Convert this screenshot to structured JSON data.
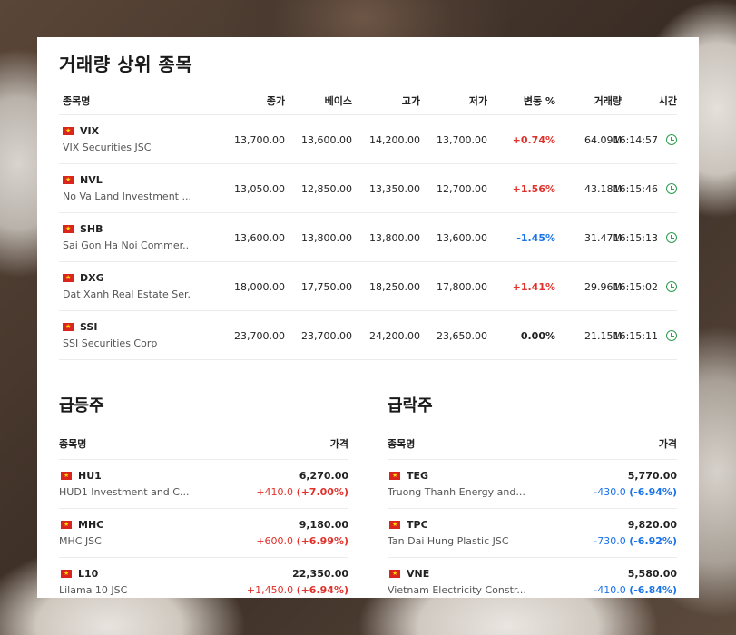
{
  "main": {
    "title": "거래량 상위 종목",
    "headers": {
      "name": "종목명",
      "price": "종가",
      "base": "베이스",
      "high": "고가",
      "low": "저가",
      "change": "변동 %",
      "volume": "거래량",
      "time": "시간"
    },
    "rows": [
      {
        "symbol": "VIX",
        "company": "VIX Securities JSC",
        "price": "13,700.00",
        "base": "13,600.00",
        "high": "14,200.00",
        "low": "13,700.00",
        "change": "+0.74%",
        "volume": "64.09M",
        "time": "16:14:57"
      },
      {
        "symbol": "NVL",
        "company": "No Va Land Investment ...",
        "price": "13,050.00",
        "base": "12,850.00",
        "high": "13,350.00",
        "low": "12,700.00",
        "change": "+1.56%",
        "volume": "43.18M",
        "time": "16:15:46"
      },
      {
        "symbol": "SHB",
        "company": "Sai Gon Ha Noi Commer...",
        "price": "13,600.00",
        "base": "13,800.00",
        "high": "13,800.00",
        "low": "13,600.00",
        "change": "-1.45%",
        "volume": "31.47M",
        "time": "16:15:13"
      },
      {
        "symbol": "DXG",
        "company": "Dat Xanh Real Estate Ser...",
        "price": "18,000.00",
        "base": "17,750.00",
        "high": "18,250.00",
        "low": "17,800.00",
        "change": "+1.41%",
        "volume": "29.96M",
        "time": "16:15:02"
      },
      {
        "symbol": "SSI",
        "company": "SSI Securities Corp",
        "price": "23,700.00",
        "base": "23,700.00",
        "high": "24,200.00",
        "low": "23,650.00",
        "change": "0.00%",
        "volume": "21.15M",
        "time": "16:15:11"
      }
    ]
  },
  "gainers": {
    "title": "급등주",
    "header_name": "종목명",
    "header_price": "가격",
    "rows": [
      {
        "symbol": "HU1",
        "company": "HUD1 Investment and C...",
        "price": "6,270.00",
        "abs": "+410.0",
        "pct": "(+7.00%)"
      },
      {
        "symbol": "MHC",
        "company": "MHC JSC",
        "price": "9,180.00",
        "abs": "+600.0",
        "pct": "(+6.99%)"
      },
      {
        "symbol": "L10",
        "company": "Lilama 10 JSC",
        "price": "22,350.00",
        "abs": "+1,450.0",
        "pct": "(+6.94%)"
      }
    ]
  },
  "losers": {
    "title": "급락주",
    "header_name": "종목명",
    "header_price": "가격",
    "rows": [
      {
        "symbol": "TEG",
        "company": "Truong Thanh Energy and...",
        "price": "5,770.00",
        "abs": "-430.0",
        "pct": "(-6.94%)"
      },
      {
        "symbol": "TPC",
        "company": "Tan Dai Hung Plastic JSC",
        "price": "9,820.00",
        "abs": "-730.0",
        "pct": "(-6.92%)"
      },
      {
        "symbol": "VNE",
        "company": "Vietnam Electricity Constr...",
        "price": "5,580.00",
        "abs": "-410.0",
        "pct": "(-6.84%)"
      }
    ]
  },
  "colors": {
    "up": "#e0322b",
    "down": "#1a73e8",
    "clock": "#2e9e4f",
    "flag": "#da251d"
  },
  "icons": {
    "flag": "vietnam-flag-icon",
    "time": "clock-icon"
  }
}
